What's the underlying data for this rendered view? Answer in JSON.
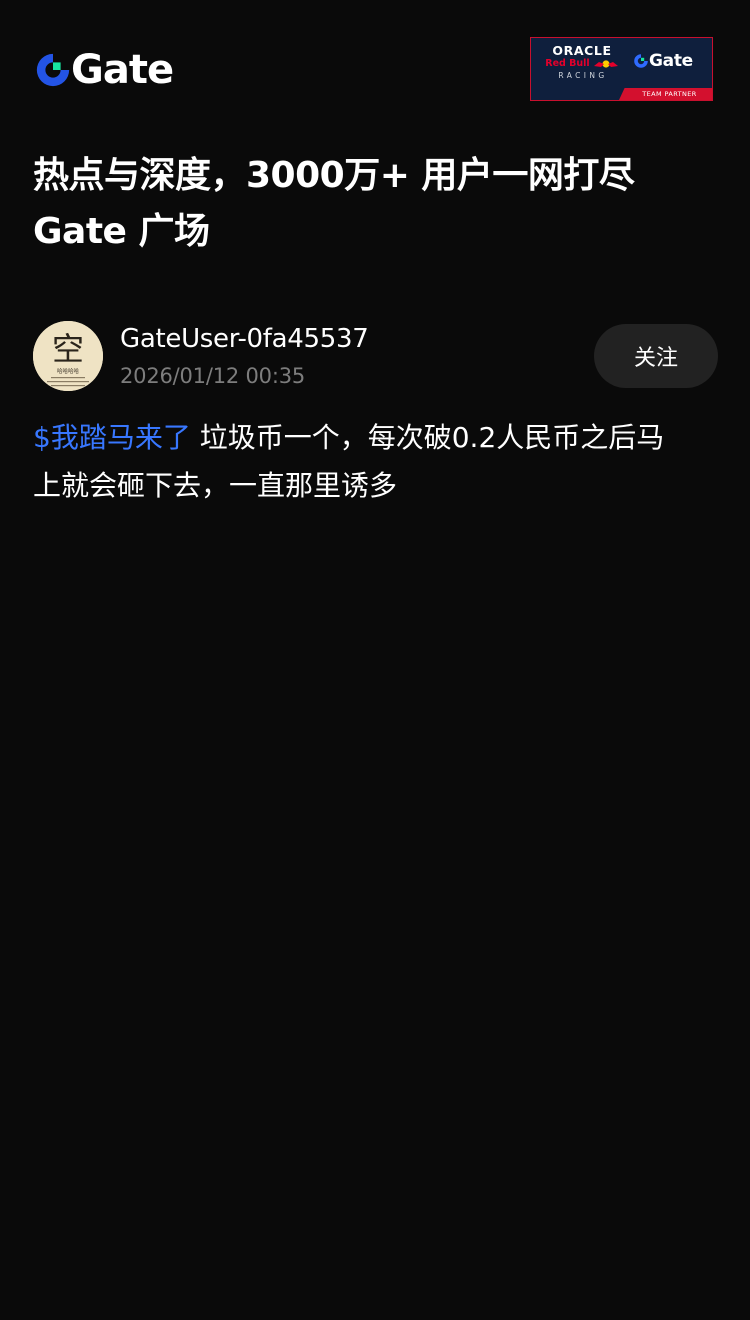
{
  "header": {
    "logo_text": "Gate",
    "partner_banner": {
      "brand_line": "ORACLE",
      "team_line": "Red Bull",
      "racing_line": "RACING",
      "partner_logo_text": "Gate",
      "badge_text": "TEAM PARTNER"
    }
  },
  "headline": {
    "line1": "热点与深度，3000万+ 用户一网打尽",
    "line2": "Gate 广场"
  },
  "post": {
    "author": {
      "username": "GateUser-0fa45537",
      "avatar_char": "空",
      "avatar_caption": "哈哈哈哈"
    },
    "timestamp": "2026/01/12 00:35",
    "follow_label": "关注",
    "coin_tag": "$我踏马来了",
    "text_line1": " 垃圾币一个，每次破0.2人民币之后马",
    "text_line2": "上就会砸下去，一直那里诱多"
  },
  "colors": {
    "background": "#0a0a0a",
    "brand_blue": "#2354e6",
    "brand_green": "#17e6a1",
    "link_blue": "#3877ff",
    "muted_text": "#7d7d7d",
    "button_bg": "#222222"
  }
}
